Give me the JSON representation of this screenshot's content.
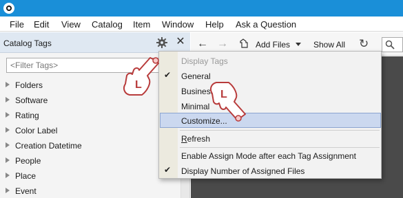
{
  "menubar": {
    "items": [
      "File",
      "Edit",
      "View",
      "Catalog",
      "Item",
      "Window",
      "Help",
      "Ask a Question"
    ]
  },
  "panel": {
    "title": "Catalog Tags",
    "close_glyph": "✕",
    "filter_placeholder": "<Filter Tags>",
    "tree_items": [
      "Folders",
      "Software",
      "Rating",
      "Color Label",
      "Creation Datetime",
      "People",
      "Place",
      "Event"
    ]
  },
  "toolbar": {
    "back_glyph": "←",
    "forward_glyph": "→",
    "add_files_label": "Add Files",
    "show_all_label": "Show All",
    "refresh_glyph": "↻"
  },
  "dropdown": {
    "header": "Display Tags",
    "items": [
      {
        "label": "General",
        "checked": true
      },
      {
        "label": "Business",
        "checked": false
      },
      {
        "label": "Minimal",
        "checked": false
      },
      {
        "label": "Customize...",
        "checked": false,
        "highlighted": true
      },
      {
        "label": "Refresh",
        "checked": false,
        "underline_first": true
      },
      {
        "label": "Enable Assign Mode after each Tag Assignment",
        "checked": false
      },
      {
        "label": "Display Number of Assigned Files",
        "checked": true
      }
    ],
    "check_glyph": "✔"
  },
  "annotations": {
    "hand_letter": "L"
  },
  "colors": {
    "titlebar": "#1a8fd8",
    "panel_header": "#dfe8f2",
    "highlight": "#cbd8ef",
    "content_bg": "#4a4a4a",
    "hand_outline": "#b83b3b"
  }
}
